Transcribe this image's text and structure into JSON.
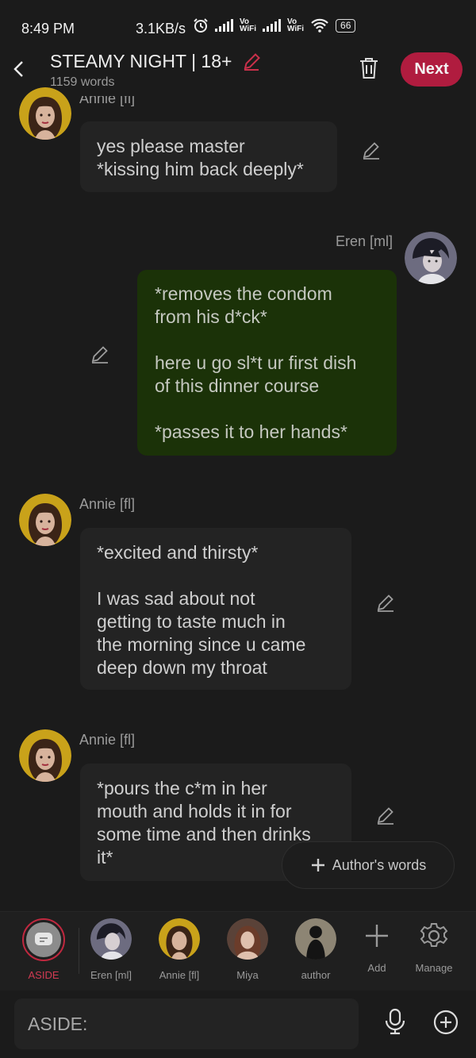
{
  "status": {
    "time": "8:49 PM",
    "speed": "3.1KB/s",
    "wifi_tag_top": "Vo",
    "wifi_tag_bottom": "WiFi",
    "battery": "66"
  },
  "header": {
    "title": "STEAMY NIGHT | 18+",
    "word_count": "1159 words",
    "next_label": "Next"
  },
  "messages": [
    {
      "name": "Annie [fl]",
      "text": "yes please master\n*kissing him back deeply*"
    },
    {
      "name": "Eren [ml]",
      "text": "*removes the condom\nfrom his d*ck*\n\nhere u go sl*t ur first dish\nof this dinner course\n\n*passes it to her hands*"
    },
    {
      "name": "Annie [fl]",
      "text": "*excited and thirsty*\n\nI was sad about not\ngetting to taste much in\nthe morning since u came\ndeep down my throat"
    },
    {
      "name": "Annie [fl]",
      "text": "*pours the c*m in her\nmouth and holds it in for\nsome time and then drinks\nit*"
    }
  ],
  "author_words_label": "Author's words",
  "characters": [
    {
      "label": "ASIDE"
    },
    {
      "label": "Eren [ml]"
    },
    {
      "label": "Annie [fl]"
    },
    {
      "label": "Miya"
    },
    {
      "label": "author"
    },
    {
      "label": "Add"
    },
    {
      "label": "Manage"
    }
  ],
  "input": {
    "placeholder": "ASIDE:"
  },
  "colors": {
    "accent": "#b01c3f",
    "user_bubble": "#1b3208",
    "bubble": "#232323",
    "background": "#1b1b1b"
  }
}
